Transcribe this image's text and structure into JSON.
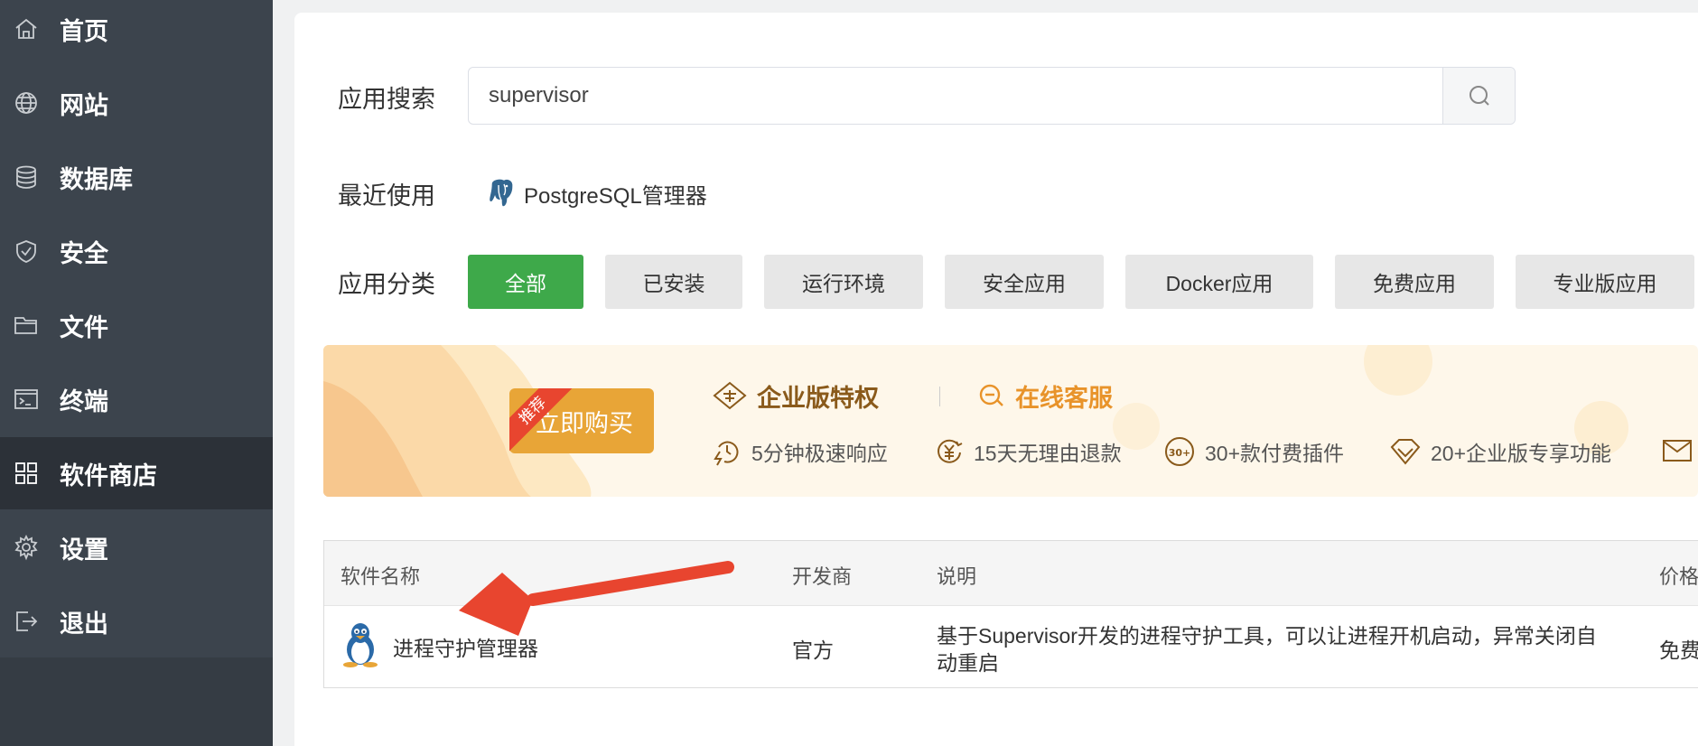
{
  "sidebar": {
    "items": [
      {
        "label": "首页",
        "icon": "home-icon"
      },
      {
        "label": "网站",
        "icon": "globe-icon"
      },
      {
        "label": "数据库",
        "icon": "database-icon"
      },
      {
        "label": "安全",
        "icon": "shield-icon"
      },
      {
        "label": "文件",
        "icon": "folder-icon"
      },
      {
        "label": "终端",
        "icon": "terminal-icon"
      },
      {
        "label": "软件商店",
        "icon": "grid-icon",
        "active": true
      },
      {
        "label": "设置",
        "icon": "gear-icon"
      },
      {
        "label": "退出",
        "icon": "logout-icon"
      }
    ]
  },
  "search": {
    "label": "应用搜索",
    "value": "supervisor"
  },
  "recent": {
    "label": "最近使用",
    "items": [
      {
        "label": "PostgreSQL管理器",
        "icon": "postgresql-elephant-icon"
      }
    ]
  },
  "categories": {
    "label": "应用分类",
    "items": [
      "全部",
      "已安装",
      "运行环境",
      "安全应用",
      "Docker应用",
      "免费应用",
      "专业版应用"
    ],
    "active_index": 0
  },
  "promo": {
    "buy_label": "立即购买",
    "ribbon": "推荐",
    "enterprise_title": "企业版特权",
    "support_title": "在线客服",
    "features": [
      {
        "label": "5分钟极速响应",
        "icon": "clock-bolt-icon"
      },
      {
        "label": "15天无理由退款",
        "icon": "yen-refund-icon"
      },
      {
        "label": "30+款付费插件",
        "icon": "plugins-30-icon"
      },
      {
        "label": "20+企业版专享功能",
        "icon": "diamond-icon"
      }
    ]
  },
  "table": {
    "headers": [
      "软件名称",
      "开发商",
      "说明",
      "价格"
    ],
    "rows": [
      {
        "name": "进程守护管理器",
        "icon": "linux-tux-icon",
        "developer": "官方",
        "description_line1": "基于Supervisor开发的进程守护工具，可以让进程开机启动，异常关闭自",
        "description_line2": "动重启",
        "price": "免费"
      }
    ]
  },
  "colors": {
    "sidebar_bg": "#3c444d",
    "sidebar_active": "#2c3138",
    "accent_green": "#3ea94a",
    "promo_orange": "#e8a537",
    "annotation_arrow": "#e8452f"
  }
}
